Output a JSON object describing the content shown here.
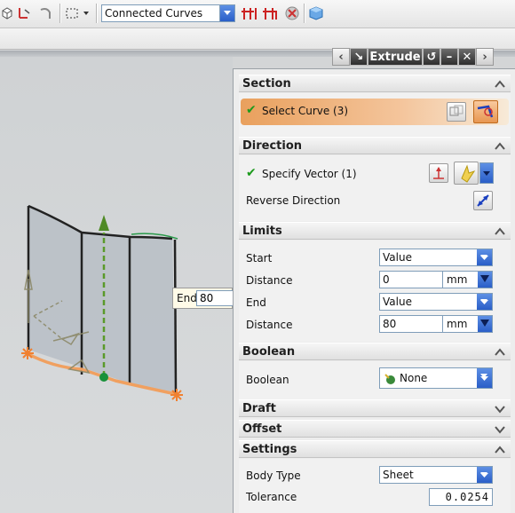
{
  "toolbar": {
    "curve_rule": "Connected Curves",
    "icons": [
      "view-cube-icon",
      "snap-arrow-icon",
      "curve-arrow-icon",
      "selection-box-icon",
      "dropdown-arrow-icon",
      "point-snap-icon",
      "intersect-snap-icon",
      "clear-selection-icon",
      "solid-cube-icon"
    ]
  },
  "dialog": {
    "title": "Extrude",
    "sections": {
      "section": {
        "title": "Section",
        "select_curve": "Select Curve (3)"
      },
      "direction": {
        "title": "Direction",
        "specify_vector": "Specify Vector (1)",
        "reverse_direction": "Reverse Direction"
      },
      "limits": {
        "title": "Limits",
        "start_label": "Start",
        "start_value": "Value",
        "distance1_label": "Distance",
        "distance1_value": "0",
        "distance1_unit": "mm",
        "end_label": "End",
        "end_value": "Value",
        "distance2_label": "Distance",
        "distance2_value": "80",
        "distance2_unit": "mm"
      },
      "boolean": {
        "title": "Boolean",
        "label": "Boolean",
        "value": "None"
      },
      "draft": {
        "title": "Draft"
      },
      "offset": {
        "title": "Offset"
      },
      "settings": {
        "title": "Settings",
        "body_type_label": "Body Type",
        "body_type_value": "Sheet",
        "tolerance_label": "Tolerance",
        "tolerance_value": "0.0254"
      }
    }
  },
  "viewport": {
    "end_handle_label": "End",
    "end_handle_value": "80"
  },
  "colors": {
    "accent_orange": "#f0a060",
    "check_green": "#1c9a1c",
    "dropdown_blue": "#2a5ec8"
  }
}
